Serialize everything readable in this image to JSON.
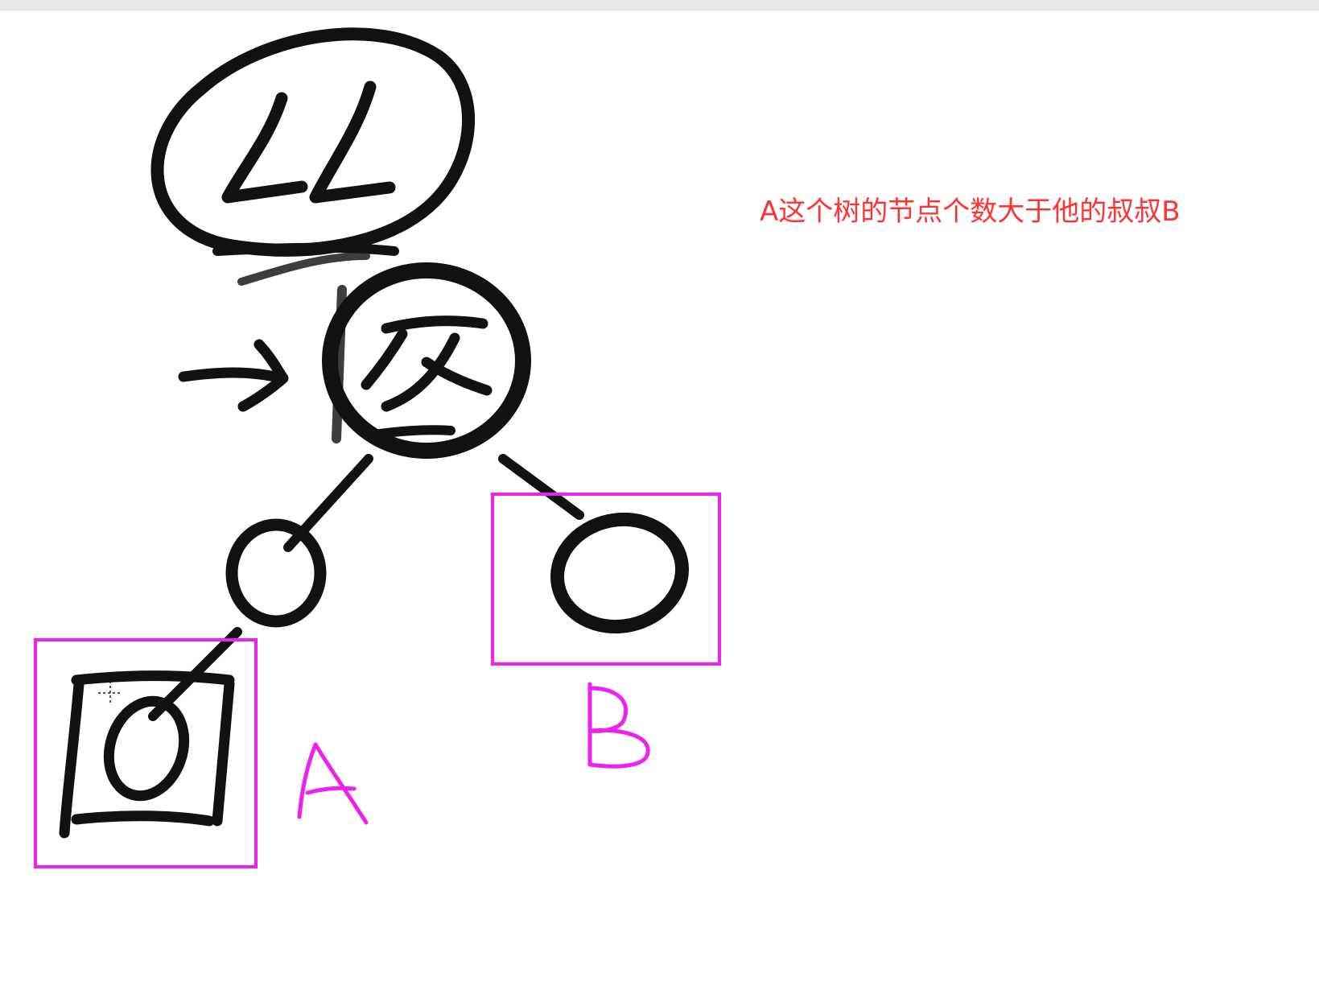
{
  "annotation": {
    "text": "A这个树的节点个数大于他的叔叔B",
    "color": "#ff3333"
  },
  "nodes": {
    "grandparent_label": "LL",
    "labels": {
      "a": "A",
      "b": "B"
    }
  },
  "colors": {
    "ink": "#111111",
    "highlight": "#ee22ee",
    "background": "#ffffff"
  }
}
